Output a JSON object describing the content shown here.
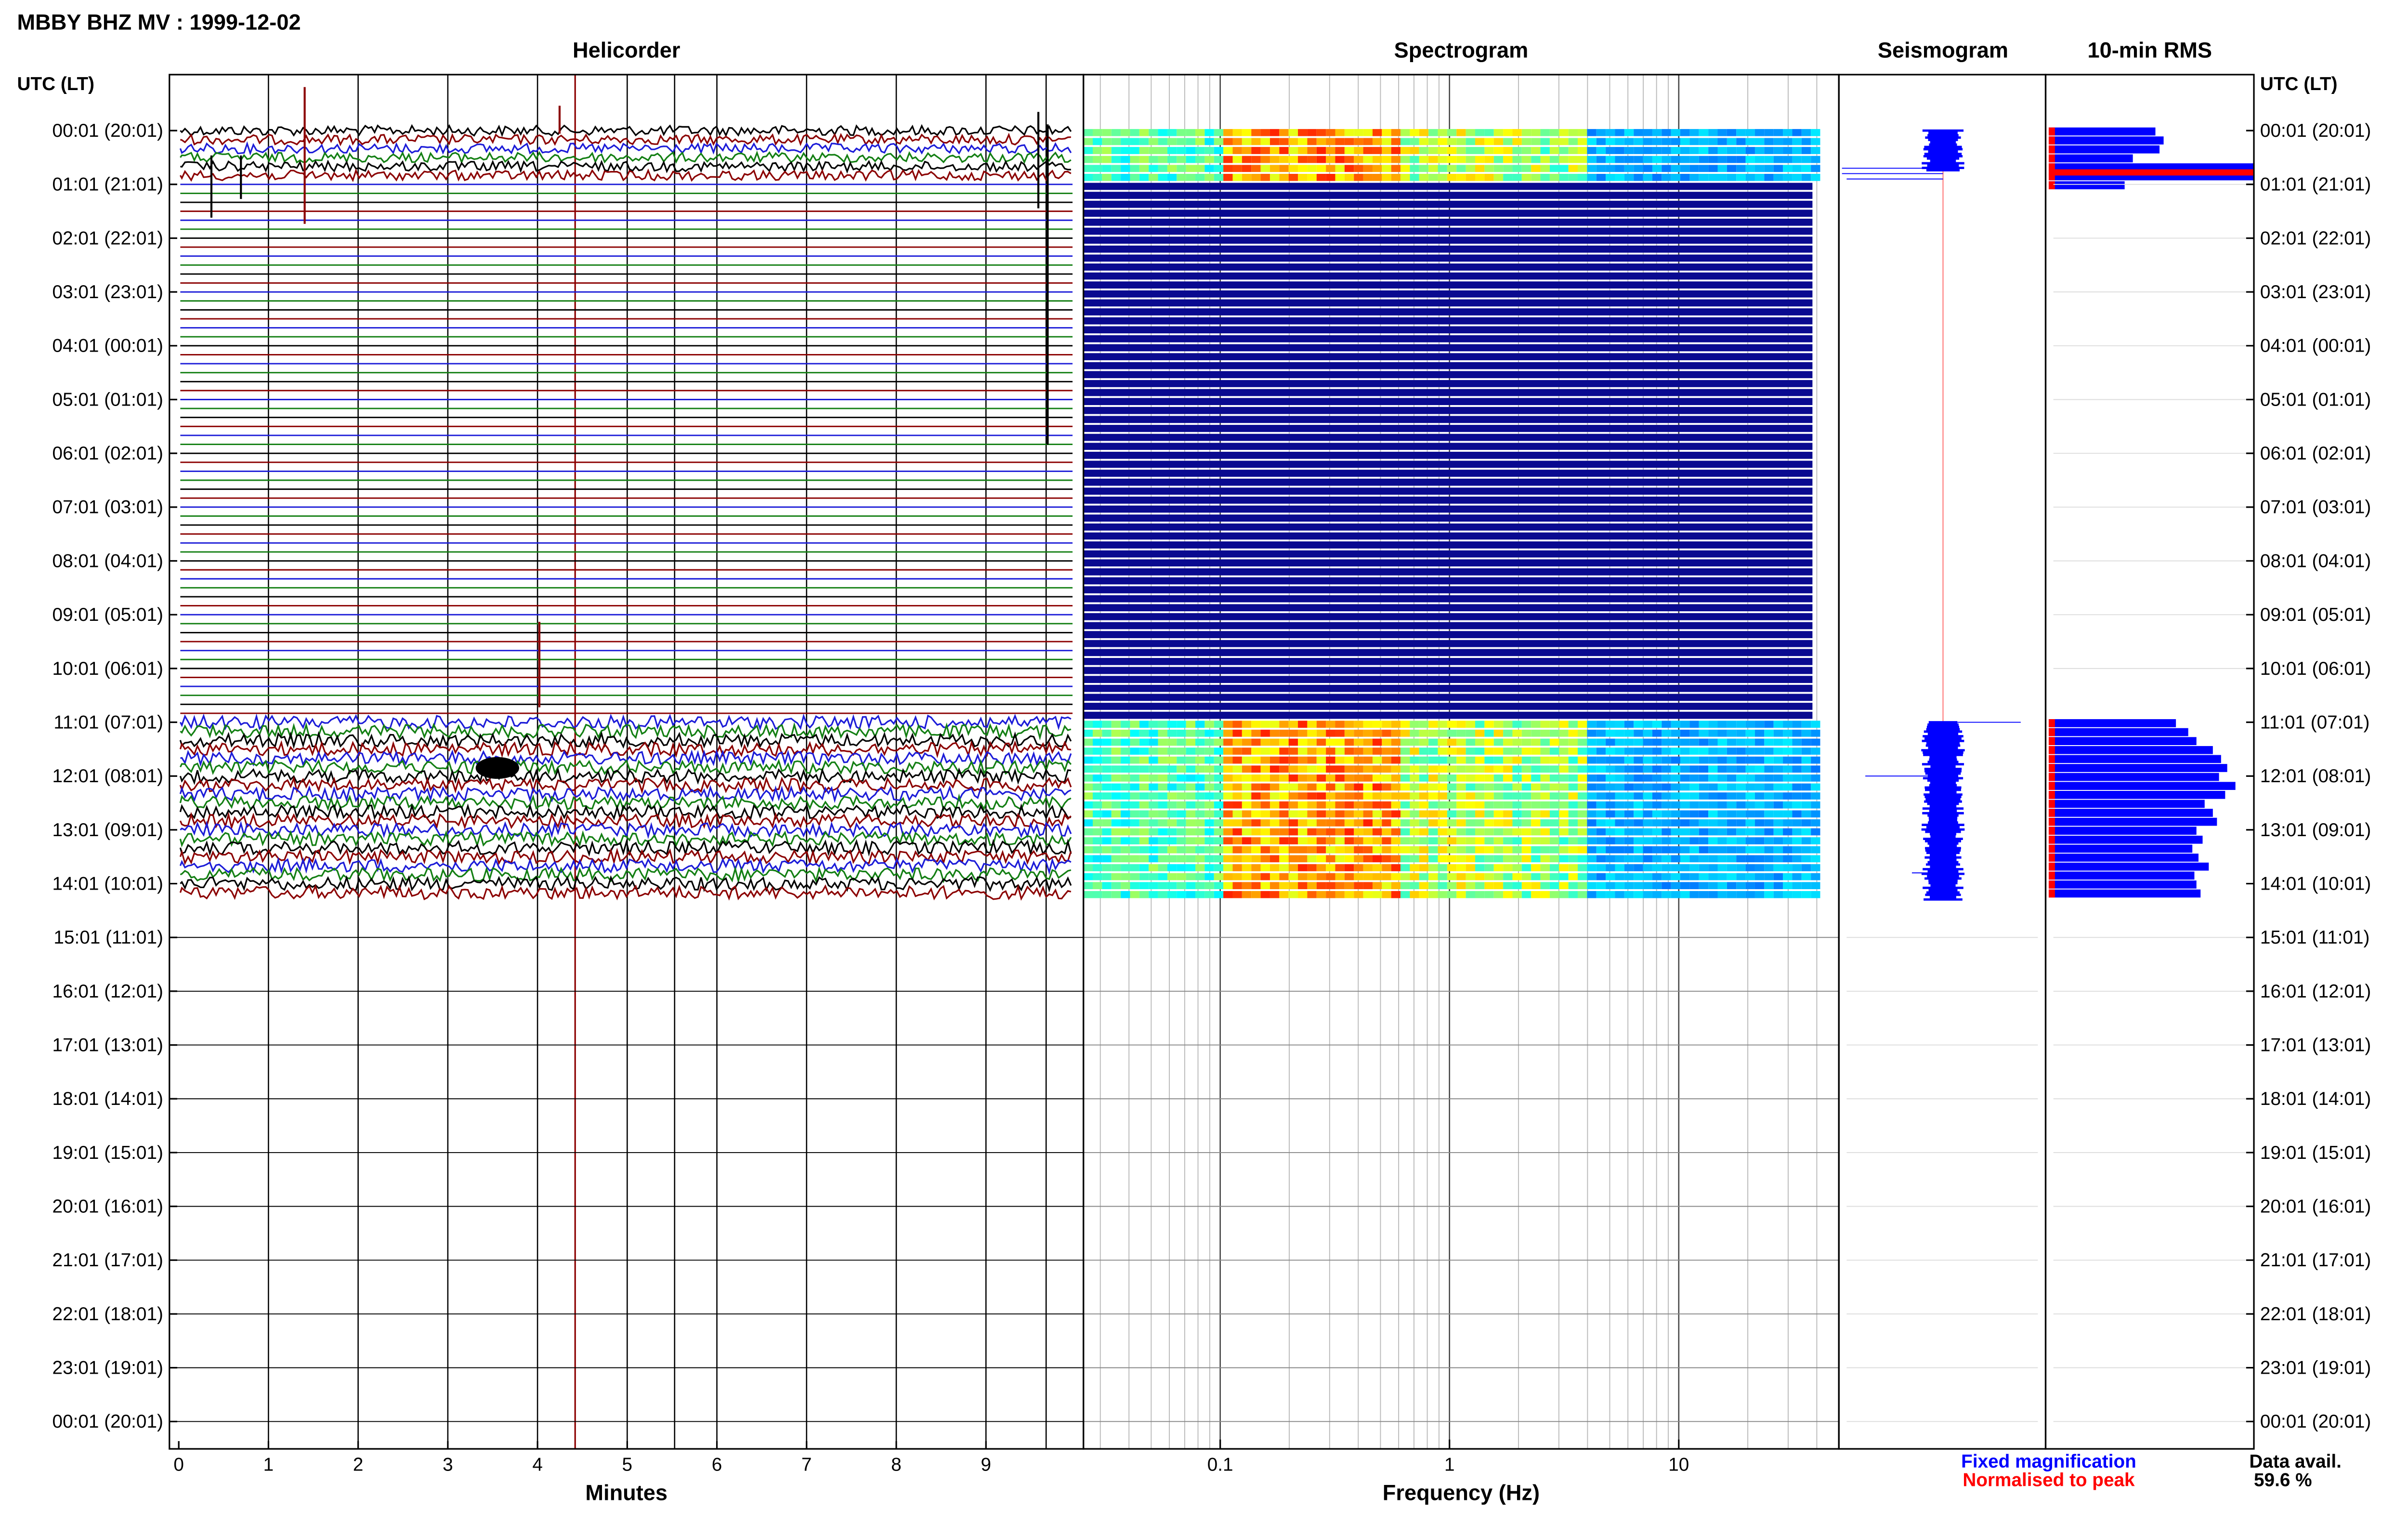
{
  "header": {
    "title": "MBBY BHZ MV : 1999-12-02"
  },
  "panels": {
    "helicorder": "Helicorder",
    "spectrogram": "Spectrogram",
    "seismogram": "Seismogram",
    "rms": "10-min RMS"
  },
  "axes": {
    "time_header_left": "UTC (LT)",
    "time_header_right": "UTC (LT)",
    "minutes_label": "Minutes",
    "frequency_label": "Frequency (Hz)"
  },
  "footer": {
    "fixed_label": "Fixed magnification",
    "normalised_label": "Normalised to peak",
    "avail_label": "Data avail.",
    "avail_value": "59.6 %"
  },
  "colors": {
    "trace_cycle": [
      "#000000",
      "#8b0000",
      "#1c1cd8",
      "#137f13"
    ],
    "spec_empty": "#0a0a90",
    "fixed": "#0000ff",
    "normalised": "#ff0000"
  },
  "chart_data": [
    {
      "type": "line",
      "title": "Helicorder",
      "xlabel": "Minutes",
      "x_ticks": [
        "0",
        "1",
        "2",
        "3",
        "4",
        "5",
        "6",
        "7",
        "8",
        "9"
      ],
      "xlim": [
        0,
        10
      ],
      "y_ticks_utc": [
        "00:01",
        "01:01",
        "02:01",
        "03:01",
        "04:01",
        "05:01",
        "06:01",
        "07:01",
        "08:01",
        "09:01",
        "10:01",
        "11:01",
        "12:01",
        "13:01",
        "14:01",
        "15:01",
        "16:01",
        "17:01",
        "18:01",
        "19:01",
        "20:01",
        "21:01",
        "22:01",
        "23:01",
        "00:01"
      ],
      "y_ticks_lt": [
        "(20:01)",
        "(21:01)",
        "(22:01)",
        "(23:01)",
        "(00:01)",
        "(01:01)",
        "(02:01)",
        "(03:01)",
        "(04:01)",
        "(05:01)",
        "(06:01)",
        "(07:01)",
        "(08:01)",
        "(09:01)",
        "(10:01)",
        "(11:01)",
        "(12:01)",
        "(13:01)",
        "(14:01)",
        "(15:01)",
        "(16:01)",
        "(17:01)",
        "(18:01)",
        "(19:01)",
        "(20:01)"
      ],
      "data_windows_utc": [
        [
          "00:01",
          "01:01"
        ],
        [
          "11:01",
          "14:11"
        ]
      ]
    },
    {
      "type": "heatmap",
      "title": "Spectrogram",
      "xlabel": "Frequency (Hz)",
      "x_scale": "log",
      "x_ticks": [
        "0.1",
        "1",
        "10"
      ],
      "xlim": [
        0.025,
        50
      ],
      "color_scale": "jet",
      "gap_hours_utc": [
        "01:01",
        "11:01"
      ]
    },
    {
      "type": "line",
      "title": "Seismogram",
      "data_windows_utc": [
        [
          "00:01",
          "01:01"
        ],
        [
          "11:01",
          "14:11"
        ]
      ]
    },
    {
      "type": "bar",
      "title": "10-min RMS",
      "series": [
        {
          "name": "Fixed magnification",
          "values_hours_0_1": [
            0.52,
            0.56,
            0.54,
            0.41,
            1.0,
            1.0,
            0.37
          ],
          "values_hours_11_14": [
            0.62,
            0.68,
            0.72,
            0.8,
            0.84,
            0.87,
            0.83,
            0.91,
            0.86,
            0.76,
            0.8,
            0.82,
            0.72,
            0.75,
            0.7,
            0.73,
            0.78,
            0.71,
            0.72,
            0.74
          ]
        },
        {
          "name": "Normalised to peak",
          "values": [
            0.04,
            0.04
          ]
        }
      ]
    }
  ]
}
